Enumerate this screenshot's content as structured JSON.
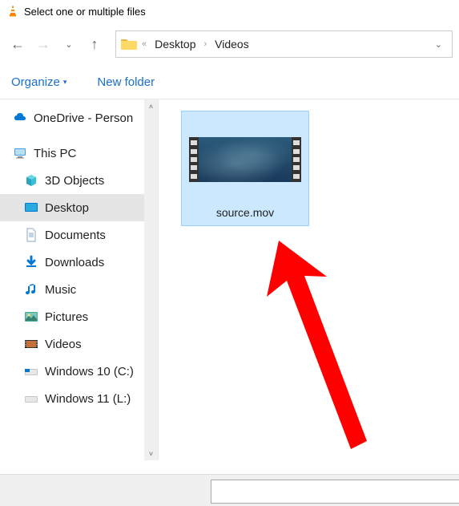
{
  "window": {
    "title": "Select one or multiple files"
  },
  "breadcrumb": {
    "part1": "Desktop",
    "part2": "Videos"
  },
  "toolbar": {
    "organize": "Organize",
    "new_folder": "New folder"
  },
  "sidebar": {
    "onedrive": "OneDrive - Person",
    "thispc": "This PC",
    "items": [
      {
        "label": "3D Objects"
      },
      {
        "label": "Desktop"
      },
      {
        "label": "Documents"
      },
      {
        "label": "Downloads"
      },
      {
        "label": "Music"
      },
      {
        "label": "Pictures"
      },
      {
        "label": "Videos"
      },
      {
        "label": "Windows 10 (C:)"
      },
      {
        "label": "Windows 11 (L:)"
      }
    ]
  },
  "files": {
    "selected": {
      "name": "source.mov"
    }
  }
}
